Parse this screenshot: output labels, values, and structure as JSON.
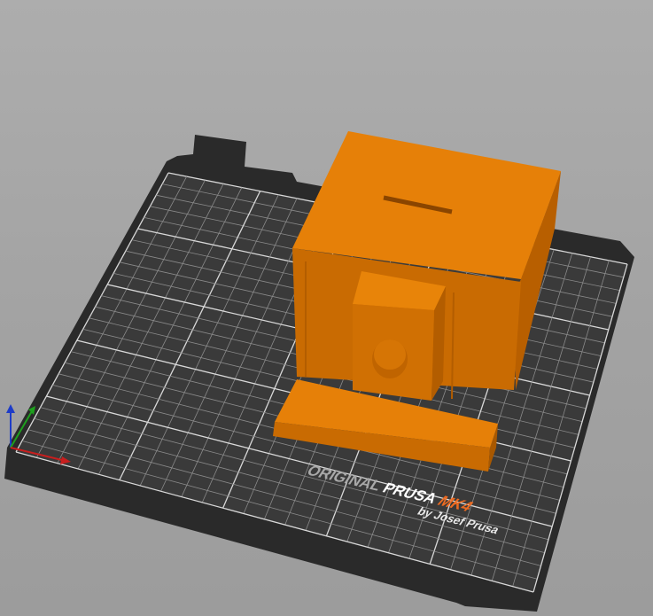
{
  "viewport": {
    "mode": "3D view"
  },
  "bed": {
    "logo_prefix": "ORIGINAL",
    "logo_brand": "PRUSA",
    "logo_model": "MK4",
    "logo_byline": "by Josef Prusa",
    "grid_divisions": 25
  },
  "object": {
    "color": "#e07a07"
  },
  "axes": {
    "x_color": "#c81e1e",
    "y_color": "#1ea01e",
    "z_color": "#1e3cc8"
  }
}
